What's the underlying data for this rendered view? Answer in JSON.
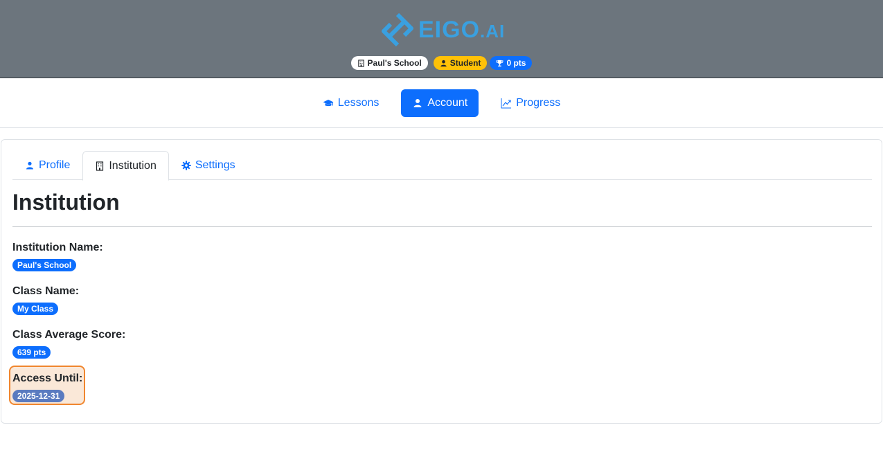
{
  "header": {
    "logo_text": "EIGO",
    "logo_suffix": ".AI",
    "badges": {
      "school": "Paul's School",
      "role": "Student",
      "points": "0 pts"
    }
  },
  "nav": {
    "items": [
      {
        "label": "Lessons",
        "icon": "graduation-cap-icon",
        "active": false
      },
      {
        "label": "Account",
        "icon": "user-icon",
        "active": true
      },
      {
        "label": "Progress",
        "icon": "chart-line-icon",
        "active": false
      }
    ]
  },
  "tabs": [
    {
      "label": "Profile",
      "icon": "user-icon",
      "active": false
    },
    {
      "label": "Institution",
      "icon": "building-icon",
      "active": true
    },
    {
      "label": "Settings",
      "icon": "gear-icon",
      "active": false
    }
  ],
  "section": {
    "title": "Institution",
    "fields": [
      {
        "label": "Institution Name:",
        "value": "Paul's School"
      },
      {
        "label": "Class Name:",
        "value": "My Class"
      },
      {
        "label": "Class Average Score:",
        "value": "639 pts"
      },
      {
        "label": "Access Until:",
        "value": "2025-12-31"
      }
    ]
  },
  "colors": {
    "header_bg": "#6c757d",
    "brand": "#3aa0e0",
    "primary": "#0d6efd",
    "warning": "#ffc107",
    "highlight_border": "#f0862e"
  }
}
